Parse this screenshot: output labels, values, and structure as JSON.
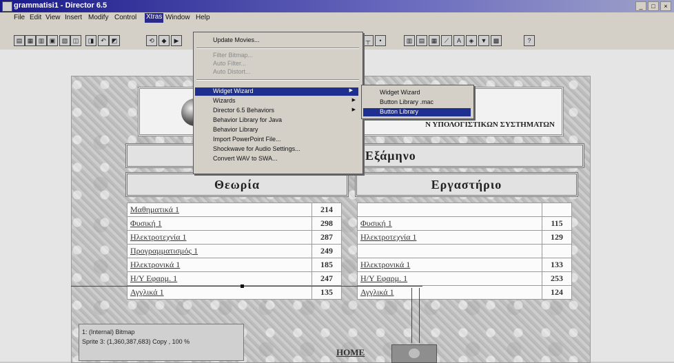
{
  "window": {
    "title": "grammatisi1 - Director 6.5",
    "controls": [
      "_",
      "□",
      "×"
    ]
  },
  "menubar": {
    "items": [
      "File",
      "Edit",
      "View",
      "Insert",
      "Modify",
      "Control",
      "Xtras",
      "Window",
      "Help"
    ]
  },
  "xtras_menu": {
    "items": [
      {
        "label": "Update Movies...",
        "state": "normal"
      },
      {
        "label": "Filter Bitmap...",
        "state": "disabled"
      },
      {
        "label": "Auto Filter...",
        "state": "disabled"
      },
      {
        "label": "Auto Distort...",
        "state": "disabled"
      },
      {
        "label": "Widget Wizard",
        "state": "selected",
        "submenu": true
      },
      {
        "label": "Wizards",
        "state": "normal",
        "submenu": true
      },
      {
        "label": "Director 6.5 Behaviors",
        "state": "normal",
        "submenu": true
      },
      {
        "label": "Behavior Library for Java",
        "state": "normal"
      },
      {
        "label": "Behavior Library",
        "state": "normal"
      },
      {
        "label": "Import PowerPoint File...",
        "state": "normal"
      },
      {
        "label": "Shockwave for Audio Settings...",
        "state": "normal"
      },
      {
        "label": "Convert WAV to SWA...",
        "state": "normal"
      }
    ]
  },
  "widget_submenu": {
    "items": [
      "Widget Wizard",
      "Button Library .mac",
      "Button Library"
    ]
  },
  "stage": {
    "logo_text": "Ν ΥΠΟΛΟΓΙΣΤΙΚΩΝ ΣΥΣΤΗΜΑΤΩΝ",
    "semester_title": "Εξάμηνο",
    "theory_title": "Θεωρία",
    "lab_title": "Εργαστήριο",
    "theory_rows": [
      {
        "name": "Μαθηματικά 1",
        "code": "214"
      },
      {
        "name": "Φυσική 1",
        "code": "298"
      },
      {
        "name": "Ηλεκτροτεχνία 1",
        "code": "287"
      },
      {
        "name": "Προγραμματισμός 1",
        "code": "249"
      },
      {
        "name": "Ηλεκτρονικά 1",
        "code": "185"
      },
      {
        "name": "Η/Υ Εφαρμ. 1",
        "code": "247"
      },
      {
        "name": "Αγγλικά 1",
        "code": "135"
      }
    ],
    "lab_rows": [
      {
        "name": "",
        "code": ""
      },
      {
        "name": "Φυσική 1",
        "code": "115"
      },
      {
        "name": "Ηλεκτροτεχνία 1",
        "code": "129"
      },
      {
        "name": "",
        "code": ""
      },
      {
        "name": "Ηλεκτρονικά 1",
        "code": "133"
      },
      {
        "name": "Η/Υ Εφαρμ. 1",
        "code": "253"
      },
      {
        "name": "Αγγλικά 1",
        "code": "124"
      }
    ],
    "home_label": "HOME"
  },
  "property_box": {
    "line1": "1: (Internal) Bitmap",
    "line2": "Sprite 3: (1,360,387,683) Copy , 100 %",
    "line3": ""
  }
}
